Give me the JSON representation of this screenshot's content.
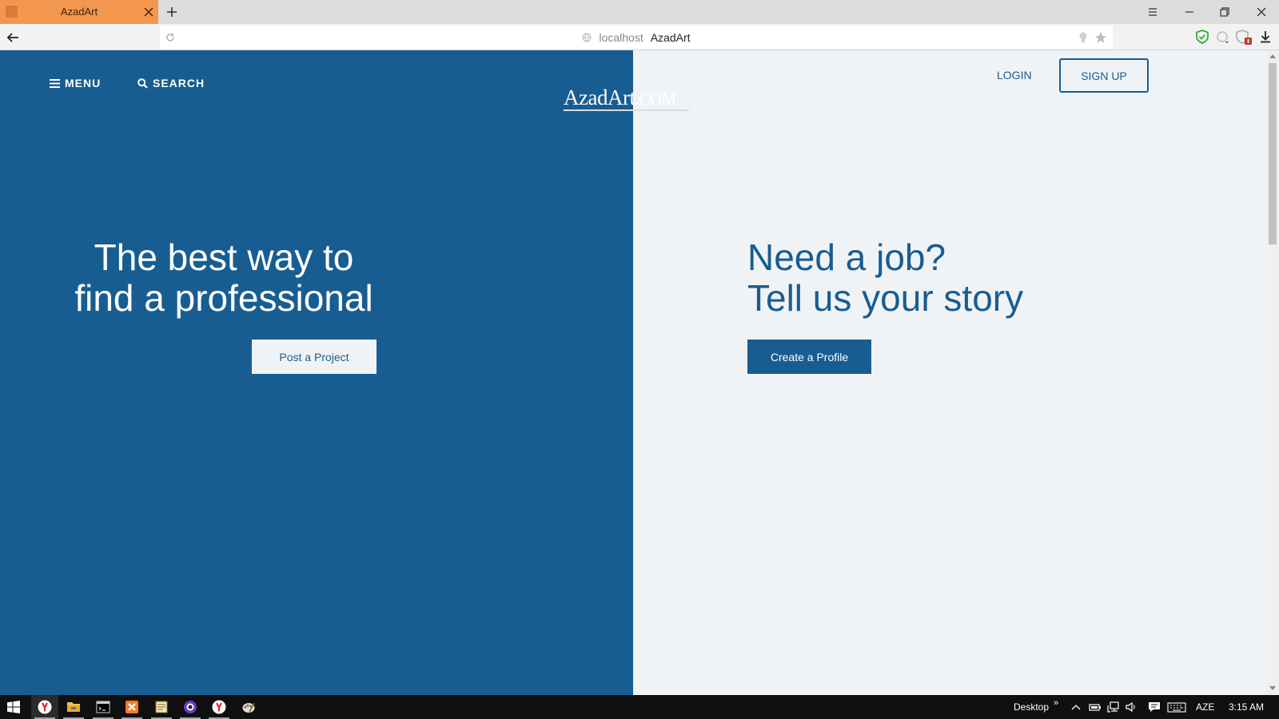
{
  "browser": {
    "tab_title": "AzadArt",
    "url_host": "localhost",
    "url_title": "AzadArt",
    "icons": [
      "favicon",
      "close-icon",
      "plus-icon",
      "hamburger-icon",
      "minimize-icon",
      "restore-icon",
      "close-icon",
      "back-arrow-icon",
      "reload-icon",
      "globe-icon",
      "lightbulb-icon",
      "star-icon",
      "shield-icon",
      "extension-icon",
      "download-icon"
    ]
  },
  "header": {
    "menu_label": "MENU",
    "search_label": "SEARCH",
    "logo_main": "AzadArt",
    "logo_domain": ".COM",
    "login_label": "LOGIN",
    "signup_label": "SIGN UP"
  },
  "hero_left": {
    "line1": "The best way to",
    "line2": "find a professional",
    "button_label": "Post a Project"
  },
  "hero_right": {
    "line1": "Need a job?",
    "line2": "Tell us your story",
    "button_label": "Create a Profile"
  },
  "taskbar": {
    "apps": [
      "start-icon",
      "yandex-browser-icon",
      "file-explorer-icon",
      "cmd-icon",
      "xampp-icon",
      "notepad-icon",
      "obs-icon",
      "yandex-browser-icon",
      "paint-icon"
    ],
    "desktop_label": "Desktop",
    "chevron": "»",
    "language": "AZE",
    "time": "3:15 AM"
  },
  "colors": {
    "brand_blue": "#185d91",
    "light_bg": "#f0f3f5",
    "tab_orange": "#f4974e",
    "taskbar": "#101010"
  }
}
